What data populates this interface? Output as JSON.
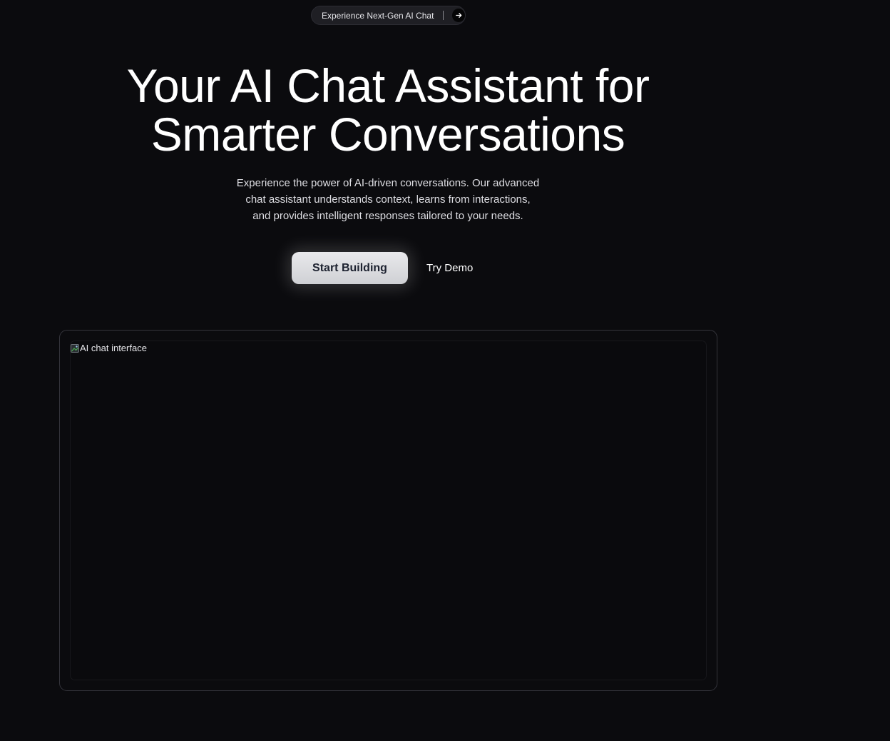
{
  "announcement": {
    "label": "Experience Next-Gen AI Chat",
    "icon": "arrow-right-icon"
  },
  "hero": {
    "title_line1": "Your AI Chat Assistant for",
    "title_line2": "Smarter Conversations",
    "description_line1": "Experience the power of AI-driven conversations. Our advanced",
    "description_line2": "chat assistant understands context, learns from interactions,",
    "description_line3": "and provides intelligent responses tailored to your needs.",
    "primary_cta": "Start Building",
    "secondary_cta": "Try Demo"
  },
  "preview": {
    "image_alt": "AI chat interface",
    "icon": "broken-image-icon"
  },
  "colors": {
    "background": "#0b0b0e",
    "pill_background": "#1f1f24",
    "primary_button": "#dcdde0",
    "primary_button_text": "#1d2230",
    "frame_border": "#34343b"
  }
}
